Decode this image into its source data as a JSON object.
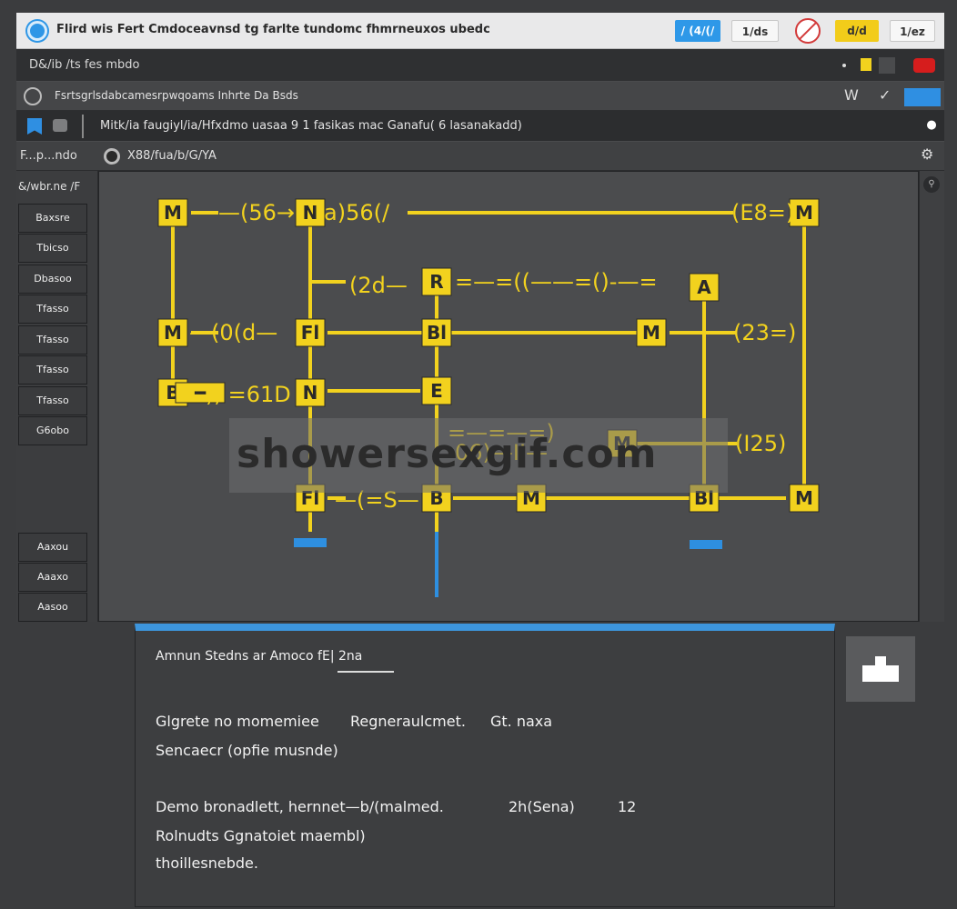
{
  "titlebar": {
    "title": "Flird wis Fert Cmdoceavnsd tg farlte tundomc fhmrneuxos ubedc",
    "btn_a": "/ (4/(/",
    "btn_b": "1/ds",
    "btn_c": "d/d",
    "btn_d": "1/ez"
  },
  "bar2": {
    "label": "D&/ib /ts fes mbdo"
  },
  "bar3": {
    "text": "Fsrtsgrlsdabcamesrpwqoams Inhrte  Da Bsds",
    "icon2": "W",
    "icon3": "✓"
  },
  "bar4": {
    "text": "Mitk/ia faugiyl/ia/Hfxdmo uasaa 9 1 fasikas mac Ganafu( 6 lasanakadd)",
    "right": "●"
  },
  "bar5": {
    "left": "F...p...ndo",
    "text": "X88/fua/b/G/YA",
    "settings": "⚙"
  },
  "sidebar": {
    "head": "&/wbr.ne /F",
    "items": [
      "Baxsre",
      "Tbicso",
      "Dbasoo",
      "Tfasso",
      "Tfasso",
      "Tfasso",
      "Tfasso",
      "G6obo"
    ],
    "bottom_items": [
      "Aaxou",
      "Aaaxo",
      "Aasoo"
    ]
  },
  "diagram": {
    "nodes": [
      {
        "label": "M"
      },
      {
        "label": "N"
      },
      {
        "label": "M"
      },
      {
        "label": "M"
      },
      {
        "label": "Fl"
      },
      {
        "label": "R"
      },
      {
        "label": "Bl"
      },
      {
        "label": "M"
      },
      {
        "label": "A"
      },
      {
        "label": "B"
      },
      {
        "label": "N"
      },
      {
        "label": "E"
      },
      {
        "label": "M"
      },
      {
        "label": "Fl"
      },
      {
        "label": "B"
      },
      {
        "label": "M"
      },
      {
        "label": "Bl"
      },
      {
        "label": "M"
      },
      {
        "label": "━"
      }
    ],
    "labels": [
      "—(56→",
      "a)56(/",
      "(E8=)",
      "(2d—",
      "=—=((——=()-—=",
      "—(0(d—",
      "(23=)",
      "), =61D",
      "=—=—=)",
      "06)—II—",
      "(I25)",
      "—(=S—"
    ],
    "watermark": "showersexgif.com"
  },
  "panel": {
    "title": "Amnun Stedns ar Amoco fE| 2na",
    "line1_a": "Glgrete no momemiee",
    "line1_b": "Regneraulcmet.",
    "line1_c": "Gt.  naxa",
    "line2": "Sencaecr (opfie musnde)",
    "line3_a": "Demo bronadlett, hernnet—b/(malmed.",
    "line3_b": "2h(Sena)",
    "line3_c": "12",
    "line4": "Rolnudts Ggnatoiet maembl)",
    "line5": "thoillesnebde."
  },
  "colors": {
    "accent": "#f2d21e",
    "blue": "#2e96e6",
    "bg": "#3b3c3e"
  }
}
